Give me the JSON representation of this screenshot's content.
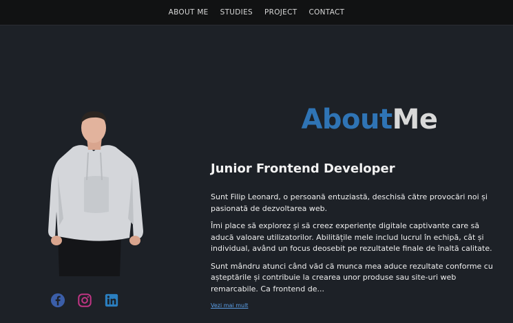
{
  "nav": {
    "items": [
      {
        "label": "ABOUT ME"
      },
      {
        "label": "STUDIES"
      },
      {
        "label": "PROJECT"
      },
      {
        "label": "CONTACT"
      }
    ]
  },
  "hero": {
    "title_part1": "About",
    "title_part2": "Me",
    "title_colors": {
      "part1": "#2f74b5",
      "part2": "#d9d9d9"
    },
    "role": "Junior Frontend Developer",
    "paragraphs": [
      "Sunt Filip Leonard, o persoană entuziastă, deschisă către provocări noi și pasionată de dezvoltarea web.",
      "Îmi place să explorez și să creez experiențe digitale captivante care să aducă valoare utilizatorilor. Abilitățile mele includ lucrul în echipă, cât și individual, având un focus deosebit pe rezultatele finale de înaltă calitate.",
      "Sunt mândru atunci când văd că munca mea aduce rezultate conforme cu așteptările și contribuie la crearea unor produse sau site-uri web remarcabile. Ca frontend de..."
    ],
    "more_link": "Vezi mai mult"
  },
  "socials": [
    {
      "icon": "facebook-icon",
      "color": "#3b5ea8"
    },
    {
      "icon": "instagram-icon",
      "color": "#c13584"
    },
    {
      "icon": "linkedin-icon",
      "color": "#2b7fc0"
    }
  ],
  "colors": {
    "background": "#1d2127",
    "navbar": "#111213",
    "link": "#5b9ee6"
  }
}
